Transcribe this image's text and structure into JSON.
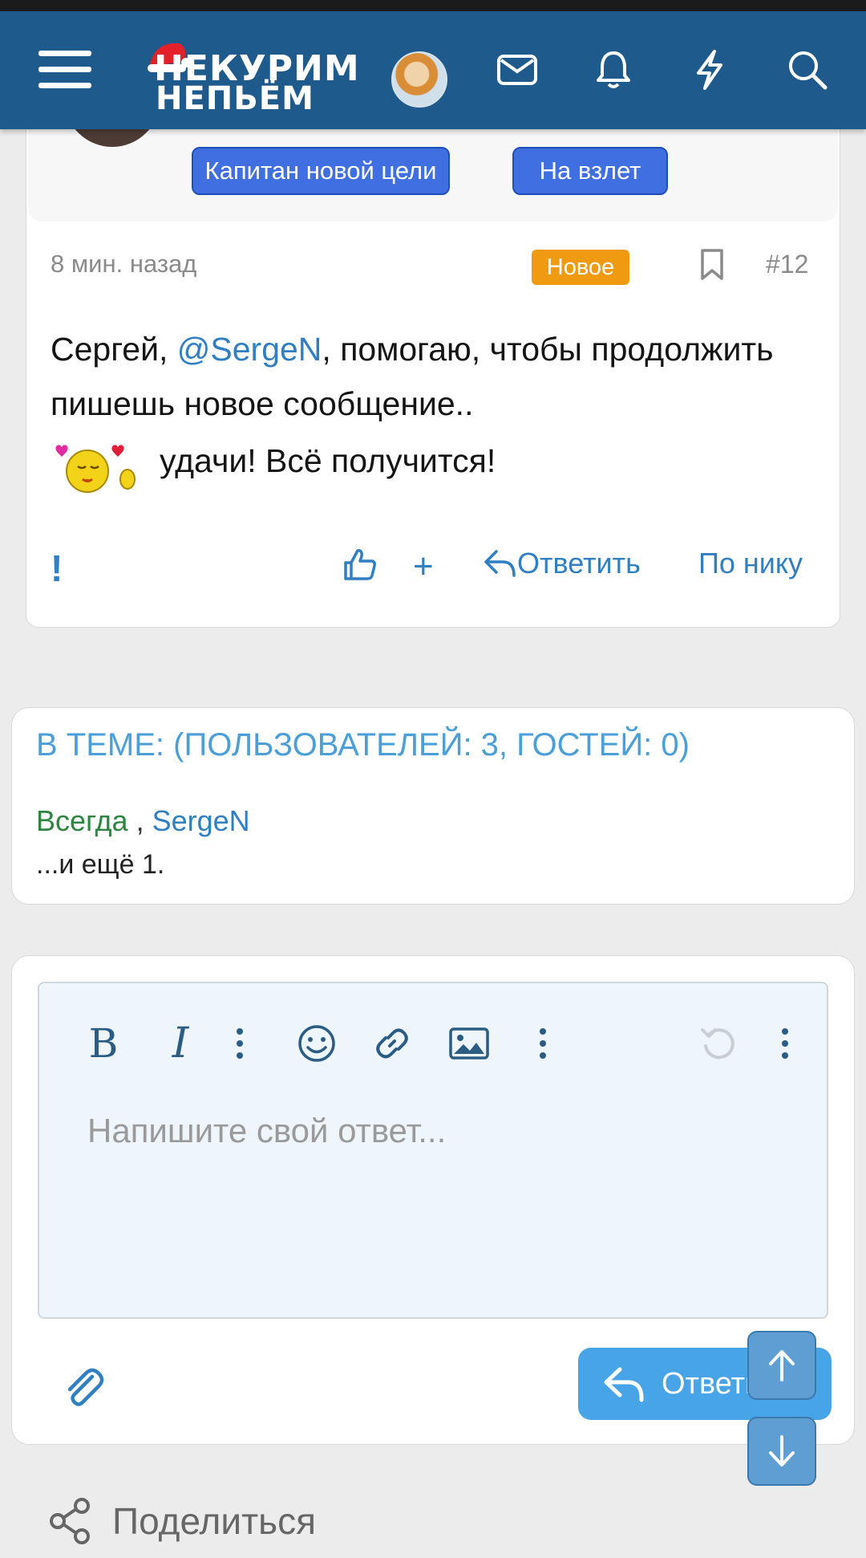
{
  "header": {
    "logo_line1": "НЕКУРИМ",
    "logo_line2": "НЕПЬЁМ"
  },
  "post": {
    "badges": [
      "Капитан новой цели",
      "На взлет"
    ],
    "time": "8 мин. назад",
    "new_label": "Новое",
    "number": "#12",
    "text_before": "Сергей, ",
    "mention": "@SergeN",
    "text_after": ", помогаю, чтобы продолжить пишешь новое сообщение..",
    "luck_text": "удачи! Всё получится!",
    "actions": {
      "report": "!",
      "plus": "+",
      "reply": "Ответить",
      "by_nick": "По нику"
    }
  },
  "thread": {
    "title": "В ТЕМЕ: (ПОЛЬЗОВАТЕЛЕЙ: 3, ГОСТЕЙ: 0)",
    "user1": "Всегда",
    "separator": " , ",
    "user2": "SergeN",
    "more": "...и ещё 1."
  },
  "editor": {
    "placeholder": "Напишите свой ответ...",
    "reply_label": "Ответить"
  },
  "share_label": "Поделиться",
  "colors": {
    "header": "#1e5a8b",
    "accent": "#2f7fc2",
    "badge": "#3f6fe0",
    "new": "#ef9a11",
    "reply_button": "#47a4e6"
  }
}
